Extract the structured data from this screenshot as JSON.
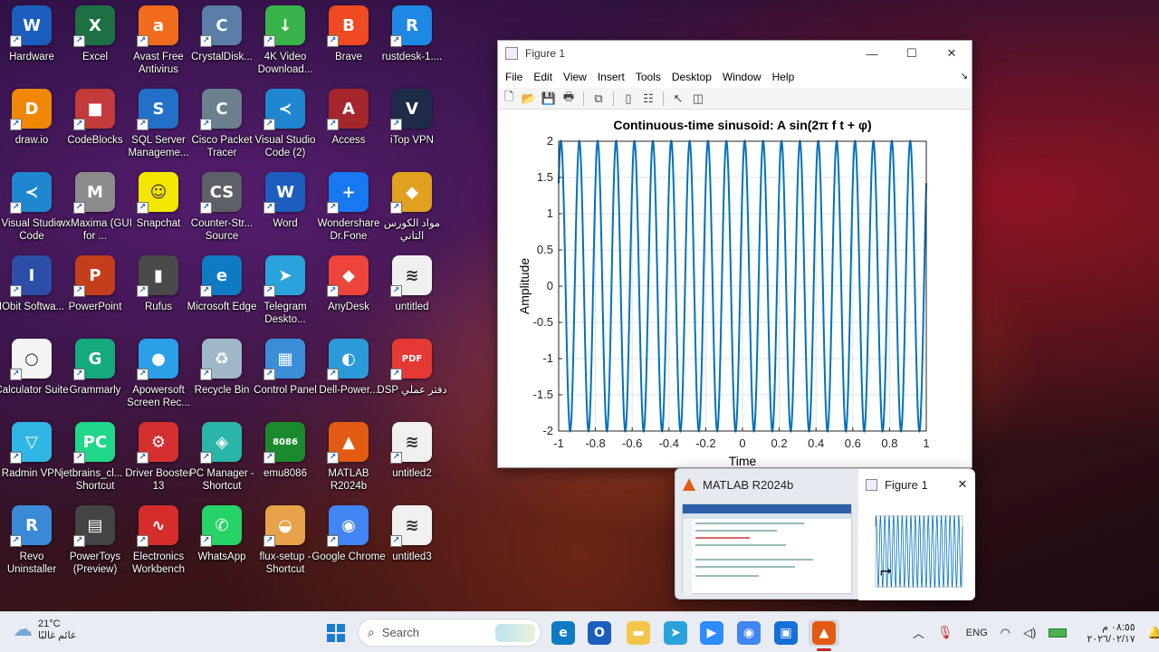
{
  "desktop": {
    "icons": [
      {
        "label": "Hardware",
        "icon": "word-icon",
        "color": "#1b5ebe",
        "glyph": "W"
      },
      {
        "label": "Excel",
        "icon": "excel-icon",
        "color": "#1d7044",
        "glyph": "X"
      },
      {
        "label": "Avast Free Antivirus",
        "icon": "avast-icon",
        "color": "#f26b1d",
        "glyph": "a"
      },
      {
        "label": "CrystalDisk...",
        "icon": "crystaldisk-icon",
        "color": "#5b7ea8",
        "glyph": "C"
      },
      {
        "label": "4K Video Download...",
        "icon": "4k-video-icon",
        "color": "#38b44a",
        "glyph": "↓"
      },
      {
        "label": "Brave",
        "icon": "brave-icon",
        "color": "#f04a23",
        "glyph": "B"
      },
      {
        "label": "rustdesk-1....",
        "icon": "rustdesk-icon",
        "color": "#1e88e5",
        "glyph": "R"
      },
      {
        "label": "draw.io",
        "icon": "drawio-icon",
        "color": "#f08705",
        "glyph": "D"
      },
      {
        "label": "CodeBlocks",
        "icon": "codeblocks-icon",
        "color": "#c23a3a",
        "glyph": "■"
      },
      {
        "label": "SQL Server Manageme...",
        "icon": "sql-server-icon",
        "color": "#2270c8",
        "glyph": "S"
      },
      {
        "label": "Cisco Packet Tracer",
        "icon": "cisco-icon",
        "color": "#6b7f8e",
        "glyph": "C"
      },
      {
        "label": "Visual Studio Code (2)",
        "icon": "vscode-icon",
        "color": "#1f87d0",
        "glyph": "≺"
      },
      {
        "label": "Access",
        "icon": "access-icon",
        "color": "#a4262c",
        "glyph": "A"
      },
      {
        "label": "iTop VPN",
        "icon": "itop-vpn-icon",
        "color": "#1e2c4a",
        "glyph": "V"
      },
      {
        "label": "Visual Studio Code",
        "icon": "vscode-icon",
        "color": "#1f87d0",
        "glyph": "≺"
      },
      {
        "label": "wxMaxima (GUI for ...",
        "icon": "wxmaxima-icon",
        "color": "#8b8b8b",
        "glyph": "M"
      },
      {
        "label": "Snapchat",
        "icon": "snapchat-icon",
        "color": "#f5e600",
        "glyph": "☺"
      },
      {
        "label": "Counter-Str... Source",
        "icon": "counter-strike-icon",
        "color": "#5d6066",
        "glyph": "CS"
      },
      {
        "label": "Word",
        "icon": "word-icon",
        "color": "#1b5ebe",
        "glyph": "W"
      },
      {
        "label": "Wondershare Dr.Fone",
        "icon": "drfone-icon",
        "color": "#1778f2",
        "glyph": "+"
      },
      {
        "label": "مواد الكورس التاني",
        "icon": "folder-icon",
        "color": "#e0a020",
        "glyph": "◆"
      },
      {
        "label": "IObit Softwa...",
        "icon": "iobit-icon",
        "color": "#2c4ea8",
        "glyph": "I"
      },
      {
        "label": "PowerPoint",
        "icon": "powerpoint-icon",
        "color": "#c43e1c",
        "glyph": "P"
      },
      {
        "label": "Rufus",
        "icon": "rufus-icon",
        "color": "#4a4a4a",
        "glyph": "▮"
      },
      {
        "label": "Microsoft Edge",
        "icon": "edge-icon",
        "color": "#0f7ac4",
        "glyph": "e"
      },
      {
        "label": "Telegram Deskto...",
        "icon": "telegram-icon",
        "color": "#2aa3dd",
        "glyph": "➤"
      },
      {
        "label": "AnyDesk",
        "icon": "anydesk-icon",
        "color": "#ef443b",
        "glyph": "◆"
      },
      {
        "label": "untitled",
        "icon": "matlab-file-icon",
        "color": "#f0f0f0",
        "glyph": "≋"
      },
      {
        "label": "Calculator Suite",
        "icon": "geogebra-icon",
        "color": "#f4f4f4",
        "glyph": "○"
      },
      {
        "label": "Grammarly",
        "icon": "grammarly-icon",
        "color": "#15a97e",
        "glyph": "G"
      },
      {
        "label": "Apowersoft Screen Rec...",
        "icon": "apowersoft-icon",
        "color": "#2ba0e8",
        "glyph": "●"
      },
      {
        "label": "Recycle Bin",
        "icon": "recycle-bin-icon",
        "color": "#9fb8c8",
        "glyph": "♻"
      },
      {
        "label": "Control Panel",
        "icon": "control-panel-icon",
        "color": "#3a8ed8",
        "glyph": "▦"
      },
      {
        "label": "Dell-Power...",
        "icon": "dell-power-icon",
        "color": "#2a9bd8",
        "glyph": "◐"
      },
      {
        "label": "DSP دفتر عملي",
        "icon": "pdf-icon",
        "color": "#e53935",
        "glyph": "PDF"
      },
      {
        "label": "Radmin VPN",
        "icon": "radmin-icon",
        "color": "#2fb6e5",
        "glyph": "▽"
      },
      {
        "label": "jetbrains_cl... - Shortcut",
        "icon": "jetbrains-icon",
        "color": "#21d789",
        "glyph": "PC"
      },
      {
        "label": "Driver Booster 13",
        "icon": "driver-booster-icon",
        "color": "#d32f2f",
        "glyph": "⚙"
      },
      {
        "label": "PC Manager - Shortcut",
        "icon": "pc-manager-icon",
        "color": "#29b6a8",
        "glyph": "◈"
      },
      {
        "label": "emu8086",
        "icon": "emu8086-icon",
        "color": "#1b8a2e",
        "glyph": "8086"
      },
      {
        "label": "MATLAB R2024b",
        "icon": "matlab-icon",
        "color": "#e35a12",
        "glyph": "▲"
      },
      {
        "label": "untitled2",
        "icon": "matlab-file-icon",
        "color": "#f0f0f0",
        "glyph": "≋"
      },
      {
        "label": "Revo Uninstaller",
        "icon": "revo-icon",
        "color": "#3b8ad8",
        "glyph": "R"
      },
      {
        "label": "PowerToys (Preview)",
        "icon": "powertoys-icon",
        "color": "#444",
        "glyph": "▤"
      },
      {
        "label": "Electronics Workbench",
        "icon": "workbench-icon",
        "color": "#d62c2c",
        "glyph": "∿"
      },
      {
        "label": "WhatsApp",
        "icon": "whatsapp-icon",
        "color": "#25d366",
        "glyph": "✆"
      },
      {
        "label": "flux-setup - Shortcut",
        "icon": "flux-icon",
        "color": "#e8a34a",
        "glyph": "◒"
      },
      {
        "label": "Google Chrome",
        "icon": "chrome-icon",
        "color": "#4285f4",
        "glyph": "◉"
      },
      {
        "label": "untitled3",
        "icon": "matlab-file-icon",
        "color": "#f0f0f0",
        "glyph": "≋"
      }
    ]
  },
  "figure": {
    "title": "Figure 1",
    "menus": [
      "File",
      "Edit",
      "View",
      "Insert",
      "Tools",
      "Desktop",
      "Window",
      "Help"
    ],
    "toolbar_icons": [
      "new-figure-icon",
      "open-icon",
      "save-icon",
      "print-icon",
      "link-icon",
      "colorbar-icon",
      "legend-icon",
      "pointer-icon",
      "plot-tools-icon"
    ]
  },
  "chart_data": {
    "type": "line",
    "title": "Continuous-time sinusoid: A sin(2π f t + φ)",
    "xlabel": "Time",
    "ylabel": "Amplitude",
    "xlim": [
      -1,
      1
    ],
    "ylim": [
      -2,
      2
    ],
    "xticks": [
      "-1",
      "-0.8",
      "-0.6",
      "-0.4",
      "-0.2",
      "0",
      "0.2",
      "0.4",
      "0.6",
      "0.8",
      "1"
    ],
    "yticks": [
      "2",
      "1.5",
      "1",
      "0.5",
      "0",
      "-0.5",
      "-1",
      "-1.5",
      "-2"
    ],
    "grid": true,
    "series": [
      {
        "amplitude": 2,
        "frequency": 10,
        "phase": 0.79,
        "color": "#0072bd"
      }
    ]
  },
  "preview": {
    "tabs": [
      {
        "label": "MATLAB R2024b",
        "icon": "matlab-icon"
      },
      {
        "label": "Figure 1",
        "icon": "figure-icon"
      }
    ],
    "close": "✕"
  },
  "taskbar": {
    "weather_temp": "21°C",
    "weather_desc": "غائم غالبًا",
    "search_placeholder": "Search",
    "language": "ENG",
    "time": "٠٨:٥٥ م",
    "date": "٢٠٢٦/٠٢/١٧",
    "pinned": [
      {
        "icon": "edge-icon",
        "color": "#0f7ac4",
        "glyph": "e"
      },
      {
        "icon": "outlook-icon",
        "color": "#1b5ebe",
        "glyph": "O"
      },
      {
        "icon": "file-explorer-icon",
        "color": "#f3c54a",
        "glyph": "▬"
      },
      {
        "icon": "telegram-icon",
        "color": "#2aa3dd",
        "glyph": "➤"
      },
      {
        "icon": "zoom-icon",
        "color": "#2d8cff",
        "glyph": "▶"
      },
      {
        "icon": "chrome-icon",
        "color": "#4285f4",
        "glyph": "◉"
      },
      {
        "icon": "store-icon",
        "color": "#1570d6",
        "glyph": "▣"
      },
      {
        "icon": "matlab-icon",
        "color": "#e35a12",
        "glyph": "▲"
      }
    ]
  }
}
